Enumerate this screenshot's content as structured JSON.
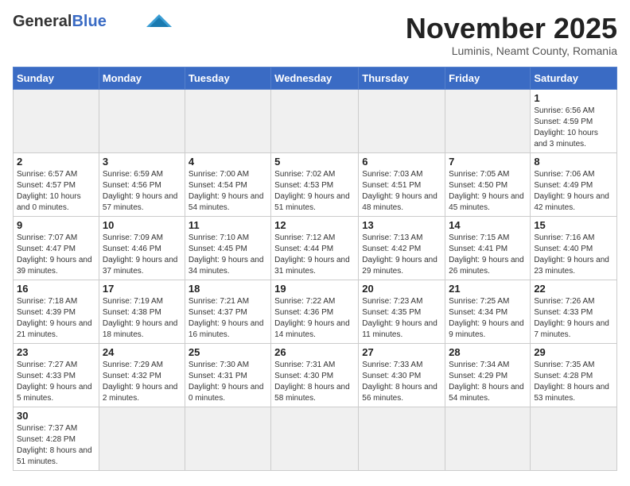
{
  "header": {
    "logo_line1": "General",
    "logo_line2": "Blue",
    "month": "November 2025",
    "location": "Luminis, Neamt County, Romania"
  },
  "weekdays": [
    "Sunday",
    "Monday",
    "Tuesday",
    "Wednesday",
    "Thursday",
    "Friday",
    "Saturday"
  ],
  "weeks": [
    [
      {
        "day": "",
        "info": ""
      },
      {
        "day": "",
        "info": ""
      },
      {
        "day": "",
        "info": ""
      },
      {
        "day": "",
        "info": ""
      },
      {
        "day": "",
        "info": ""
      },
      {
        "day": "",
        "info": ""
      },
      {
        "day": "1",
        "info": "Sunrise: 6:56 AM\nSunset: 4:59 PM\nDaylight: 10 hours\nand 3 minutes."
      }
    ],
    [
      {
        "day": "2",
        "info": "Sunrise: 6:57 AM\nSunset: 4:57 PM\nDaylight: 10 hours\nand 0 minutes."
      },
      {
        "day": "3",
        "info": "Sunrise: 6:59 AM\nSunset: 4:56 PM\nDaylight: 9 hours\nand 57 minutes."
      },
      {
        "day": "4",
        "info": "Sunrise: 7:00 AM\nSunset: 4:54 PM\nDaylight: 9 hours\nand 54 minutes."
      },
      {
        "day": "5",
        "info": "Sunrise: 7:02 AM\nSunset: 4:53 PM\nDaylight: 9 hours\nand 51 minutes."
      },
      {
        "day": "6",
        "info": "Sunrise: 7:03 AM\nSunset: 4:51 PM\nDaylight: 9 hours\nand 48 minutes."
      },
      {
        "day": "7",
        "info": "Sunrise: 7:05 AM\nSunset: 4:50 PM\nDaylight: 9 hours\nand 45 minutes."
      },
      {
        "day": "8",
        "info": "Sunrise: 7:06 AM\nSunset: 4:49 PM\nDaylight: 9 hours\nand 42 minutes."
      }
    ],
    [
      {
        "day": "9",
        "info": "Sunrise: 7:07 AM\nSunset: 4:47 PM\nDaylight: 9 hours\nand 39 minutes."
      },
      {
        "day": "10",
        "info": "Sunrise: 7:09 AM\nSunset: 4:46 PM\nDaylight: 9 hours\nand 37 minutes."
      },
      {
        "day": "11",
        "info": "Sunrise: 7:10 AM\nSunset: 4:45 PM\nDaylight: 9 hours\nand 34 minutes."
      },
      {
        "day": "12",
        "info": "Sunrise: 7:12 AM\nSunset: 4:44 PM\nDaylight: 9 hours\nand 31 minutes."
      },
      {
        "day": "13",
        "info": "Sunrise: 7:13 AM\nSunset: 4:42 PM\nDaylight: 9 hours\nand 29 minutes."
      },
      {
        "day": "14",
        "info": "Sunrise: 7:15 AM\nSunset: 4:41 PM\nDaylight: 9 hours\nand 26 minutes."
      },
      {
        "day": "15",
        "info": "Sunrise: 7:16 AM\nSunset: 4:40 PM\nDaylight: 9 hours\nand 23 minutes."
      }
    ],
    [
      {
        "day": "16",
        "info": "Sunrise: 7:18 AM\nSunset: 4:39 PM\nDaylight: 9 hours\nand 21 minutes."
      },
      {
        "day": "17",
        "info": "Sunrise: 7:19 AM\nSunset: 4:38 PM\nDaylight: 9 hours\nand 18 minutes."
      },
      {
        "day": "18",
        "info": "Sunrise: 7:21 AM\nSunset: 4:37 PM\nDaylight: 9 hours\nand 16 minutes."
      },
      {
        "day": "19",
        "info": "Sunrise: 7:22 AM\nSunset: 4:36 PM\nDaylight: 9 hours\nand 14 minutes."
      },
      {
        "day": "20",
        "info": "Sunrise: 7:23 AM\nSunset: 4:35 PM\nDaylight: 9 hours\nand 11 minutes."
      },
      {
        "day": "21",
        "info": "Sunrise: 7:25 AM\nSunset: 4:34 PM\nDaylight: 9 hours\nand 9 minutes."
      },
      {
        "day": "22",
        "info": "Sunrise: 7:26 AM\nSunset: 4:33 PM\nDaylight: 9 hours\nand 7 minutes."
      }
    ],
    [
      {
        "day": "23",
        "info": "Sunrise: 7:27 AM\nSunset: 4:33 PM\nDaylight: 9 hours\nand 5 minutes."
      },
      {
        "day": "24",
        "info": "Sunrise: 7:29 AM\nSunset: 4:32 PM\nDaylight: 9 hours\nand 2 minutes."
      },
      {
        "day": "25",
        "info": "Sunrise: 7:30 AM\nSunset: 4:31 PM\nDaylight: 9 hours\nand 0 minutes."
      },
      {
        "day": "26",
        "info": "Sunrise: 7:31 AM\nSunset: 4:30 PM\nDaylight: 8 hours\nand 58 minutes."
      },
      {
        "day": "27",
        "info": "Sunrise: 7:33 AM\nSunset: 4:30 PM\nDaylight: 8 hours\nand 56 minutes."
      },
      {
        "day": "28",
        "info": "Sunrise: 7:34 AM\nSunset: 4:29 PM\nDaylight: 8 hours\nand 54 minutes."
      },
      {
        "day": "29",
        "info": "Sunrise: 7:35 AM\nSunset: 4:28 PM\nDaylight: 8 hours\nand 53 minutes."
      }
    ],
    [
      {
        "day": "30",
        "info": "Sunrise: 7:37 AM\nSunset: 4:28 PM\nDaylight: 8 hours\nand 51 minutes."
      },
      {
        "day": "",
        "info": ""
      },
      {
        "day": "",
        "info": ""
      },
      {
        "day": "",
        "info": ""
      },
      {
        "day": "",
        "info": ""
      },
      {
        "day": "",
        "info": ""
      },
      {
        "day": "",
        "info": ""
      }
    ]
  ]
}
